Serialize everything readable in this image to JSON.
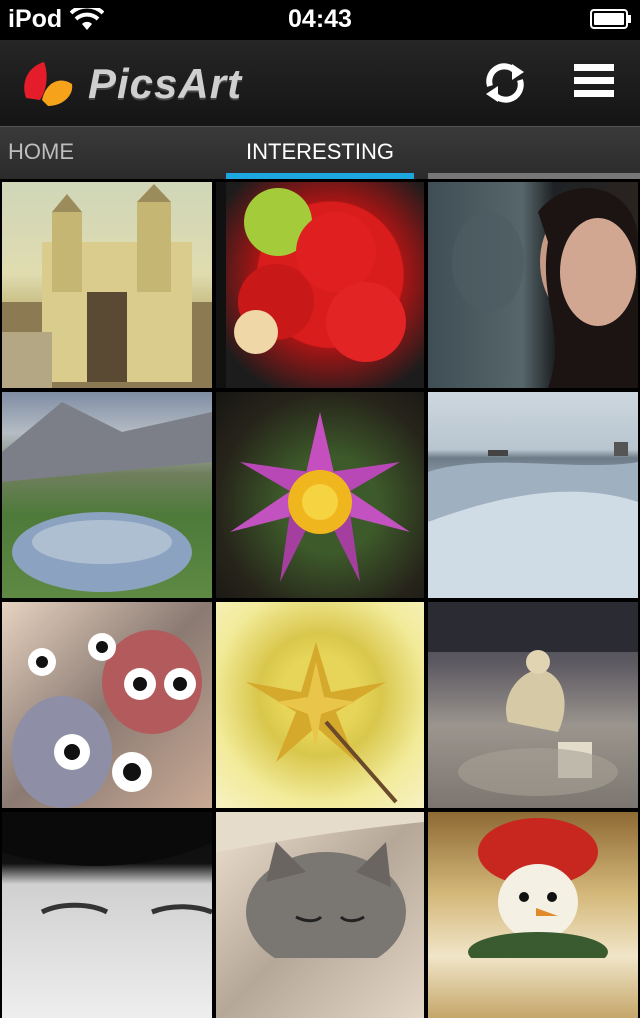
{
  "status_bar": {
    "carrier": "iPod",
    "time": "04:43"
  },
  "app": {
    "logo_text": "PicsArt",
    "refresh_icon": "refresh-icon",
    "menu_icon": "hamburger-menu-icon"
  },
  "tabs": [
    {
      "label": "HOME",
      "active": false
    },
    {
      "label": "INTERESTING",
      "active": true
    }
  ],
  "colors": {
    "accent": "#1ea6e0",
    "header_bg": "#1c1c1c",
    "tabbar_bg": "#333333"
  },
  "photos": [
    {
      "subject": "cathedral"
    },
    {
      "subject": "red flower bouquet"
    },
    {
      "subject": "girl at window"
    },
    {
      "subject": "mountain lake"
    },
    {
      "subject": "purple water lily"
    },
    {
      "subject": "snowy field"
    },
    {
      "subject": "owl figurines"
    },
    {
      "subject": "yellow flowers"
    },
    {
      "subject": "street performer"
    },
    {
      "subject": "closed eyes portrait"
    },
    {
      "subject": "cat"
    },
    {
      "subject": "snowman ornament"
    }
  ]
}
